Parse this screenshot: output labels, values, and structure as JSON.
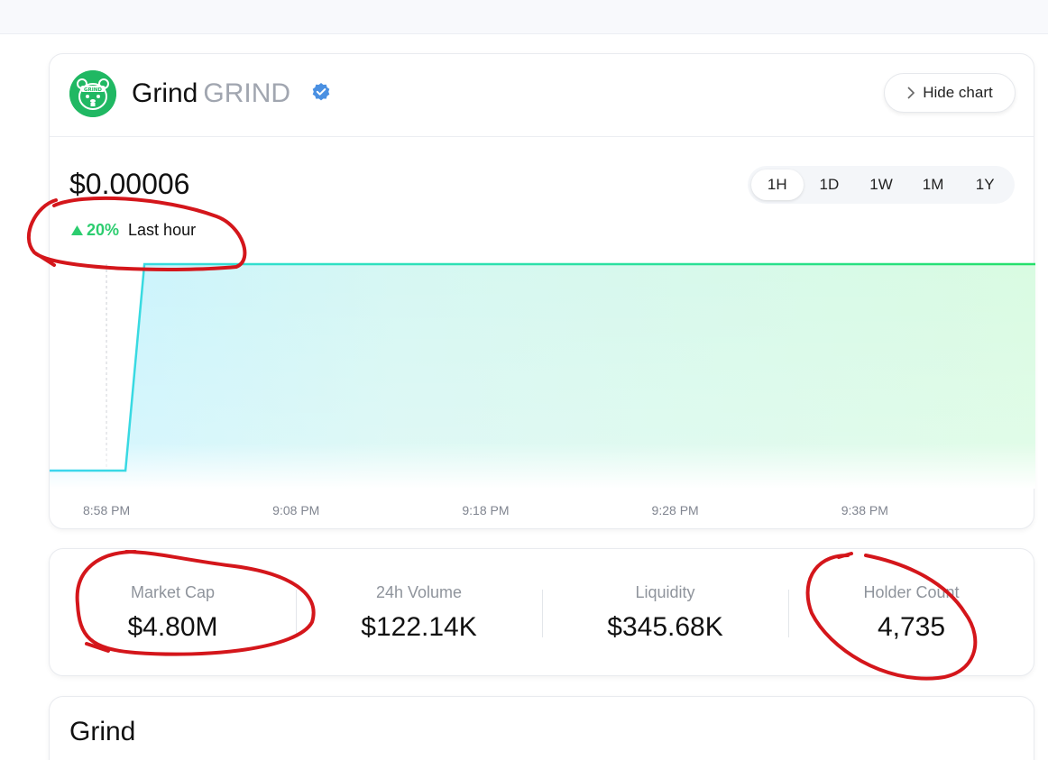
{
  "token": {
    "name": "Grind",
    "symbol": "GRIND",
    "logo_text": "GRIND",
    "hide_chart_label": "Hide chart",
    "price": "$0.00006",
    "change": "20%",
    "change_label": "Last hour"
  },
  "ranges": [
    {
      "label": "1H",
      "active": true
    },
    {
      "label": "1D",
      "active": false
    },
    {
      "label": "1W",
      "active": false
    },
    {
      "label": "1M",
      "active": false
    },
    {
      "label": "1Y",
      "active": false
    }
  ],
  "chart_data": {
    "type": "area",
    "x": [
      "8:55 PM",
      "8:59 PM",
      "9:00 PM",
      "9:47 PM"
    ],
    "y": [
      5e-05,
      5e-05,
      6e-05,
      6e-05
    ],
    "xticks": [
      "8:58 PM",
      "9:08 PM",
      "9:18 PM",
      "9:28 PM",
      "9:38 PM"
    ],
    "grid": "vertical dashed",
    "colors": {
      "start": "#3dd6ef",
      "end": "#25e06a"
    }
  },
  "stats": [
    {
      "label": "Market Cap",
      "value": "$4.80M"
    },
    {
      "label": "24h Volume",
      "value": "$122.14K"
    },
    {
      "label": "Liquidity",
      "value": "$345.68K"
    },
    {
      "label": "Holder Count",
      "value": "4,735"
    }
  ],
  "about": {
    "title": "Grind"
  },
  "colors": {
    "accent_green": "#2ccd6f",
    "annotation_red": "#d4161b",
    "verified_blue": "#4a90e2"
  }
}
